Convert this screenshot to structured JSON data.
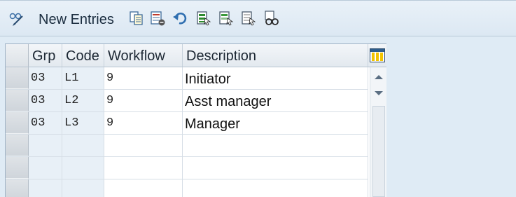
{
  "toolbar": {
    "new_entries_label": "New Entries",
    "icons": [
      "display-change-icon",
      "copy-icon",
      "delete-icon",
      "undo-icon",
      "select-all-icon",
      "select-block-icon",
      "deselect-all-icon",
      "find-icon"
    ]
  },
  "table": {
    "columns": {
      "grp": "Grp",
      "code": "Code",
      "workflow": "Workflow",
      "description": "Description"
    },
    "rows": [
      {
        "grp": "03",
        "code": "L1",
        "workflow": "9",
        "description": "Initiator"
      },
      {
        "grp": "03",
        "code": "L2",
        "workflow": "9",
        "description": "Asst manager"
      },
      {
        "grp": "03",
        "code": "L3",
        "workflow": "9",
        "description": "Manager"
      }
    ],
    "settings_icon": "column-settings-icon"
  },
  "colors": {
    "background": "#dfebf5",
    "key_cell": "#e8f0f7",
    "header": "#e3e9ef"
  }
}
